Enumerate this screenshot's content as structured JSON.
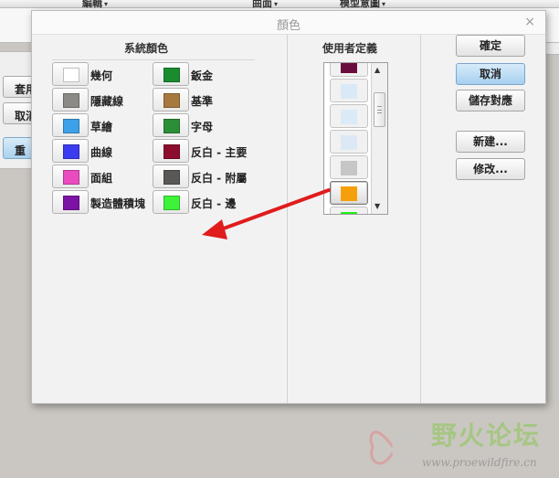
{
  "background_app": {
    "menus": [
      {
        "label": "編輯",
        "caret": "▾"
      },
      {
        "label": "曲面",
        "caret": "▾"
      },
      {
        "label": "模型意圖",
        "caret": "▾"
      }
    ],
    "side_buttons": [
      "套用",
      "取消",
      "重"
    ]
  },
  "dialog": {
    "title": "顏色",
    "close_glyph": "×",
    "system_colors": {
      "title": "系統顏色",
      "items": [
        {
          "label": "幾何",
          "color": "#ffffff"
        },
        {
          "label": "鈑金",
          "color": "#1b8c2e"
        },
        {
          "label": "隱藏線",
          "color": "#8c8a86"
        },
        {
          "label": "基準",
          "color": "#a7793f"
        },
        {
          "label": "草繪",
          "color": "#3ca1e8"
        },
        {
          "label": "字母",
          "color": "#2b8f38"
        },
        {
          "label": "曲線",
          "color": "#3b3bf0"
        },
        {
          "label": "反白 - 主要",
          "color": "#8e0c2e"
        },
        {
          "label": "面組",
          "color": "#ea4bc0"
        },
        {
          "label": "反白 - 附屬",
          "color": "#5a5856"
        },
        {
          "label": "製造體積塊",
          "color": "#7d13a6"
        },
        {
          "label": "反白 - 邊",
          "color": "#3ef23a"
        }
      ]
    },
    "user_defined": {
      "title": "使用者定義",
      "items": [
        {
          "color": "#6b0d3c",
          "selected": false
        },
        {
          "color": "#d9e9f7",
          "selected": false
        },
        {
          "color": "#dbeaf7",
          "selected": false
        },
        {
          "color": "#dce9f5",
          "selected": false
        },
        {
          "color": "#c6c6c6",
          "selected": false
        },
        {
          "color": "#f5a00a",
          "selected": true
        },
        {
          "color": "#1ff01a",
          "selected": false
        }
      ],
      "scroll_up": "▲",
      "scroll_down": "▼"
    },
    "buttons": {
      "ok": "確定",
      "cancel": "取消",
      "save_mapping": "儲存對應",
      "new": "新建...",
      "modify": "修改..."
    }
  },
  "annotation": {
    "arrow_color": "#e01c1c"
  },
  "watermark": {
    "main": "野火论坛",
    "url": "www.proewildfire.cn"
  }
}
